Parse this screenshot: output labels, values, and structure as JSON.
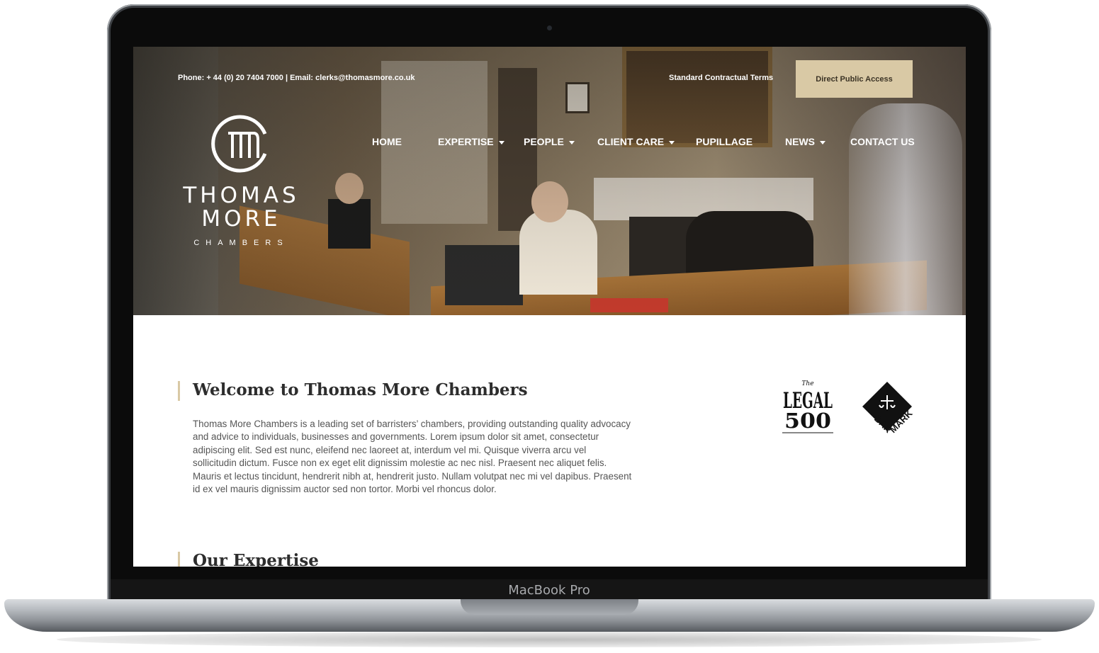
{
  "device": {
    "label": "MacBook Pro"
  },
  "topbar": {
    "contact": "Phone: + 44 (0) 20 7404 7000 | Email: clerks@thomasmore.co.uk",
    "terms_link": "Standard Contractual Terms",
    "cta_button": "Direct Public Access"
  },
  "brand": {
    "name_line1": "THOMAS",
    "name_line2": "MORE",
    "tagline": "CHAMBERS",
    "accent_color": "#d9c9a5"
  },
  "nav": {
    "items": [
      {
        "label": "HOME",
        "has_dropdown": false
      },
      {
        "label": "EXPERTISE",
        "has_dropdown": true
      },
      {
        "label": "PEOPLE",
        "has_dropdown": true
      },
      {
        "label": "CLIENT CARE",
        "has_dropdown": true
      },
      {
        "label": "PUPILLAGE",
        "has_dropdown": false
      },
      {
        "label": "NEWS",
        "has_dropdown": true
      },
      {
        "label": "CONTACT US",
        "has_dropdown": false
      }
    ]
  },
  "welcome": {
    "title": "Welcome to Thomas More Chambers",
    "body": "Thomas More Chambers is a leading set of barristers’ chambers, providing outstanding quality advocacy and advice to individuals, businesses and governments. Lorem ipsum dolor sit amet, consectetur adipiscing elit. Sed est nunc, eleifend nec laoreet at, interdum vel mi. Quisque viverra arcu vel sollicitudin dictum. Fusce non ex eget elit dignissim molestie ac nec nisl. Praesent nec aliquet felis. Mauris et lectus tincidunt, hendrerit nibh at, hendrerit justo. Nullam volutpat nec mi vel dapibus. Praesent id ex vel mauris dignissim auctor sed non tortor. Morbi vel rhoncus dolor."
  },
  "badges": {
    "legal500": {
      "small": "The",
      "line1": "LEGAL",
      "line2": "500"
    },
    "barmark": {
      "text1": "BAR",
      "text2": "MARK"
    }
  },
  "expertise": {
    "title": "Our Expertise"
  }
}
